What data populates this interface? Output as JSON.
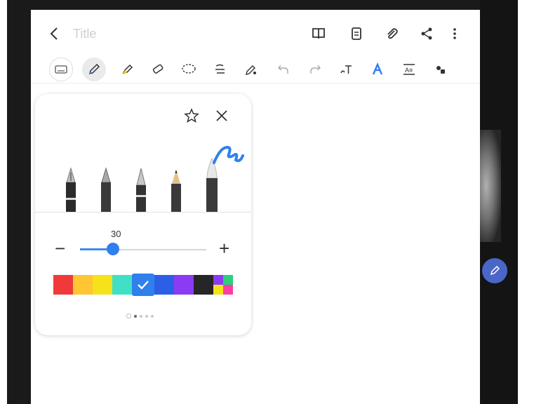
{
  "note": {
    "title_placeholder": "Title"
  },
  "header": {
    "icons": [
      "book-icon",
      "page-icon",
      "attach-icon",
      "share-icon",
      "more-icon"
    ]
  },
  "toolbar": {
    "tools": [
      "keyboard",
      "pen",
      "highlighter",
      "eraser",
      "lasso",
      "align",
      "pen-settings",
      "undo",
      "redo",
      "text",
      "text-style",
      "text-box",
      "shapes"
    ],
    "active_tool": "pen"
  },
  "pen_panel": {
    "pens": [
      "fountain-pen",
      "calligraphy-pen",
      "ballpoint-pen",
      "pencil",
      "brush"
    ],
    "size": "30",
    "size_fraction": 0.26,
    "colors": [
      "#f03a3a",
      "#ffc533",
      "#f5e21a",
      "#40e0c8",
      "#2f80ed",
      "#2b5fe6",
      "#8c3bf5",
      "#262626",
      "multicolor"
    ],
    "selected_color": "#2f80ed",
    "page_dots": 5,
    "active_dot": 1
  },
  "colors": {
    "accent": "#2f80ed"
  }
}
